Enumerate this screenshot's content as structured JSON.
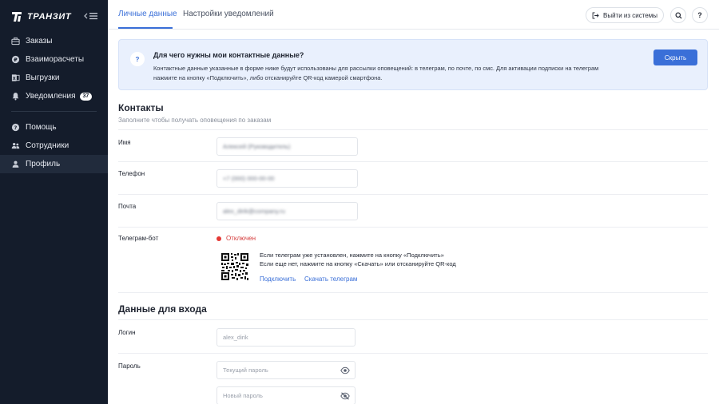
{
  "sidebar": {
    "brand": "ТРАНЗИТ",
    "items": [
      {
        "label": "Заказы",
        "icon": "briefcase-icon"
      },
      {
        "label": "Взаиморасчеты",
        "icon": "coin-icon"
      },
      {
        "label": "Выгрузки",
        "icon": "spreadsheet-icon"
      },
      {
        "label": "Уведомления",
        "icon": "bell-icon",
        "badge": "37"
      },
      {
        "label": "Помощь",
        "icon": "help-icon"
      },
      {
        "label": "Сотрудники",
        "icon": "users-icon"
      },
      {
        "label": "Профиль",
        "icon": "user-icon",
        "active": true
      }
    ]
  },
  "header": {
    "tabs": [
      "Личные данные",
      "Настройки уведомлений"
    ],
    "logout_label": "Выйти из системы",
    "help_label": "?"
  },
  "info": {
    "icon_label": "?",
    "title": "Для чего нужны мои контактные данные?",
    "text": "Контактные данные указанные в форме ниже будут использованы для рассылки оповещений: в телеграм, по почте, по смс. Для активации подписки на телеграм нажмите на кнопку «Подключить», либо отсканируйте QR-код камерой смартфона.",
    "hide_label": "Скрыть"
  },
  "contacts": {
    "title": "Контакты",
    "subtitle": "Заполните чтобы получать оповещения по заказам",
    "name_label": "Имя",
    "name_value": "Алексей (Руководитель)",
    "phone_label": "Телефон",
    "phone_value": "+7 (000) 000-00-00",
    "email_label": "Почта",
    "email_value": "alex_dirik@company.ru",
    "telegram_label": "Телеграм-бот",
    "telegram_status": "Отключен",
    "telegram_line1": "Если телеграм уже установлен, нажмите на кнопку «Подключить»",
    "telegram_line2": "Если еще нет, нажмите на кнопку «Скачать» или отсканируйте QR-код",
    "connect_label": "Подключить",
    "download_label": "Скачать телеграм"
  },
  "login": {
    "title": "Данные для входа",
    "login_label": "Логин",
    "login_value": "alex_dirik",
    "password_label": "Пароль",
    "current_password_placeholder": "Текущий пароль",
    "new_password_placeholder": "Новый пароль"
  },
  "colors": {
    "sidebar_bg": "#141c2b",
    "accent": "#3a6fd8",
    "status_off": "#e53935",
    "banner_bg": "#e9f0fd"
  }
}
